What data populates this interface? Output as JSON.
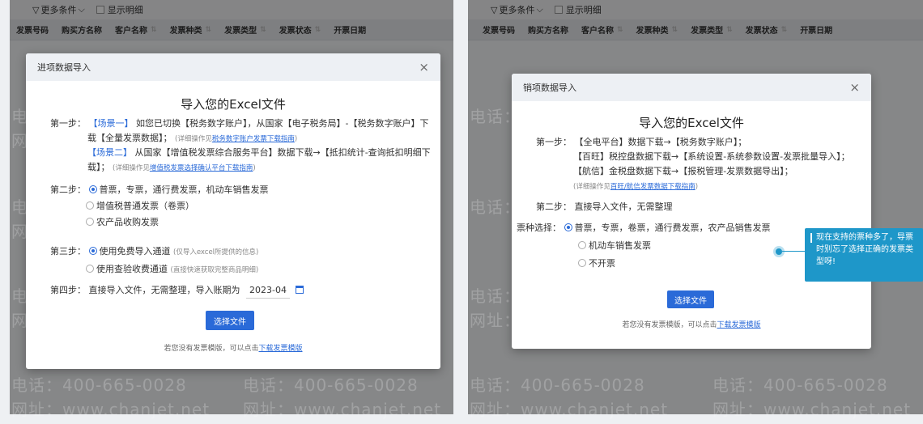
{
  "filters": {
    "more": "更多条件",
    "detail": "显示明细"
  },
  "columns": [
    "发票号码",
    "购买方名称",
    "客户名称",
    "发票种类",
    "发票类型",
    "发票状态",
    "开票日期"
  ],
  "watermark": {
    "phone": "电话：400-665-0028",
    "site": "网址：www.chanjet.net"
  },
  "left_modal": {
    "title": "进项数据导入",
    "heading": "导入您的Excel文件",
    "step1_label": "第一步：",
    "s1_tag1": "【场景一】",
    "s1_text1": "如您已切换【税务数字账户】，从国家【电子税务局】-【税务数字账户】下",
    "s1_text2": "载【全量发票数据】；",
    "s1_hint1": "(详细操作见",
    "s1_link1": "税务数字账户发票下载指南",
    "s1_hint1_end": ")",
    "s1_tag2": "【场景二】",
    "s1_text3": "从国家【增值税发票综合服务平台】数据下载→【抵扣统计-查询抵扣明细下",
    "s1_text4": "载】；",
    "s1_hint2": "(详细操作见",
    "s1_link2": "增值税发票选择确认平台下载指南",
    "s1_hint2_end": ")",
    "step2_label": "第二步：",
    "s2_opt1": "普票，专票，通行费发票，机动车销售发票",
    "s2_opt2": "增值税普通发票（卷票）",
    "s2_opt3": "农产品收购发票",
    "step3_label": "第三步：",
    "s3_opt1": "使用免费导入通道",
    "s3_opt1_hint": "(仅导入excel所提供的信息)",
    "s3_opt2": "使用查验收费通道",
    "s3_opt2_hint": "(直接快速获取完整商品明细)",
    "step4_label": "第四步：",
    "s4_text": "直接导入文件，无需整理，导入账期为",
    "s4_period": "2023-04",
    "button": "选择文件",
    "footer_text": "若您没有发票模版，可以点击",
    "footer_link": "下载发票模版"
  },
  "right_modal": {
    "title": "销项数据导入",
    "heading": "导入您的Excel文件",
    "step1_label": "第一步：",
    "s1_line1": "【全电平台】数据下载→【税务数字账户】；",
    "s1_line2": "【百旺】税控盘数据下载→【系统设置-系统参数设置-发票批量导入】；",
    "s1_line3": "【航信】金税盘数据下载→【报税管理-发票数据导出】；",
    "s1_hint": "(详细操作见",
    "s1_link": "百旺/航信发票数据下载指南",
    "s1_hint_end": ")",
    "step2_label": "第二步：",
    "s2_text": "直接导入文件，无需整理",
    "type_label": "票种选择：",
    "type_opt1": "普票，专票，卷票，通行费发票，农产品销售发票",
    "type_opt2": "机动车销售发票",
    "type_opt3": "不开票",
    "button": "选择文件",
    "footer_text": "若您没有发票模版，可以点击",
    "footer_link": "下载发票模版"
  },
  "tooltip": "现在支持的票种多了，导票时别忘了选择正确的发票类型呀!",
  "colors": {
    "accent": "#2a6ad8",
    "tooltip": "#1e97c9"
  }
}
